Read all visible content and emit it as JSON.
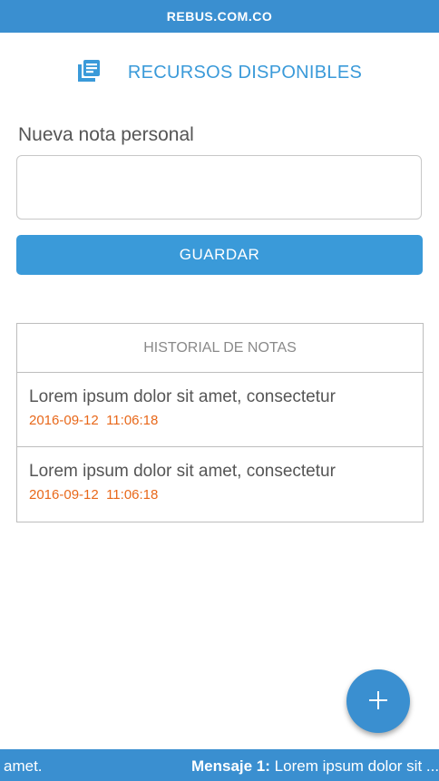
{
  "topbar": {
    "title": "REBUS.COM.CO"
  },
  "resources": {
    "title": "RECURSOS DISPONIBLES",
    "icon": "notes-list-icon"
  },
  "note": {
    "label": "Nueva nota personal",
    "placeholder": ""
  },
  "save_button": {
    "label": "GUARDAR"
  },
  "history": {
    "title": "HISTORIAL DE NOTAS",
    "items": [
      {
        "text": "Lorem ipsum dolor sit amet, consectetur",
        "date": "2016-09-12",
        "time": "11:06:18"
      },
      {
        "text": "Lorem ipsum dolor sit amet, consectetur",
        "date": "2016-09-12",
        "time": "11:06:18"
      }
    ]
  },
  "fab": {
    "icon": "plus-icon"
  },
  "ticker": {
    "left_text": "amet.",
    "message_label": "Mensaje 1:",
    "message_text": "Lorem ipsum dolor sit ..."
  },
  "colors": {
    "primary": "#3a8fd0",
    "accent_text": "#3a9ad9",
    "date": "#e8681a"
  }
}
